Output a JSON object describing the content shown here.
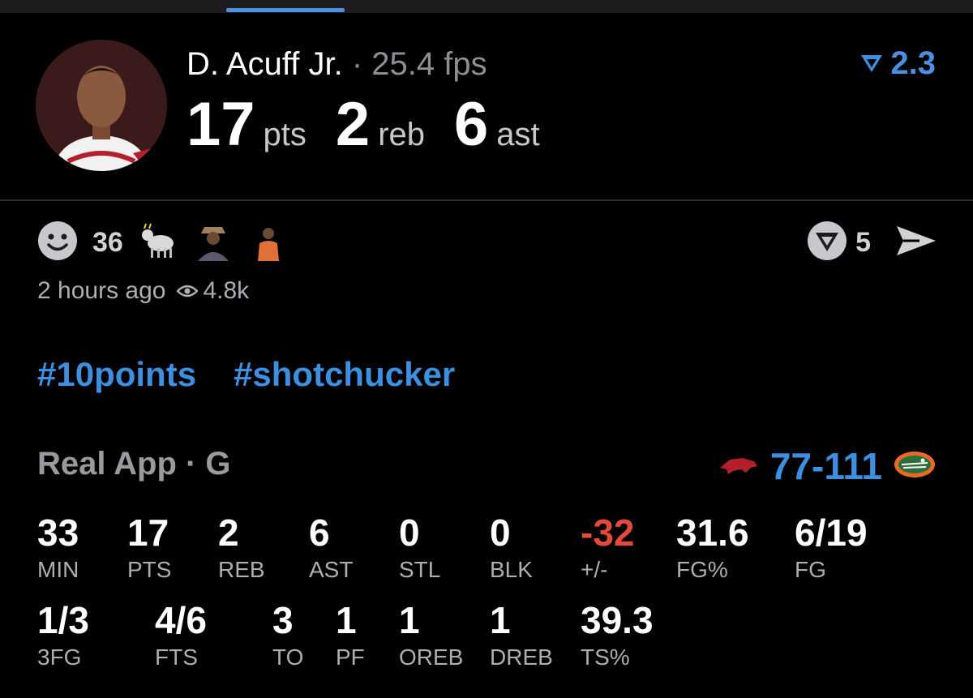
{
  "player": {
    "name": "D. Acuff Jr.",
    "separator": "·",
    "fps": "25.4 fps",
    "pts": "17",
    "pts_unit": "pts",
    "reb": "2",
    "reb_unit": "reb",
    "ast": "6",
    "ast_unit": "ast",
    "rating": "2.3"
  },
  "reactions": {
    "count": "36",
    "emojis": [
      "goat-emoji",
      "person-emoji-1",
      "person-emoji-2"
    ],
    "share_count": "5"
  },
  "meta": {
    "time": "2 hours ago",
    "views": "4.8k"
  },
  "tags": [
    "#10points",
    "#shotchucker"
  ],
  "game": {
    "league": "Real App · G",
    "score": "77-111"
  },
  "stats_row1": [
    {
      "value": "33",
      "label": "MIN"
    },
    {
      "value": "17",
      "label": "PTS"
    },
    {
      "value": "2",
      "label": "REB"
    },
    {
      "value": "6",
      "label": "AST"
    },
    {
      "value": "0",
      "label": "STL"
    },
    {
      "value": "0",
      "label": "BLK"
    },
    {
      "value": "-32",
      "label": "+/-"
    },
    {
      "value": "31.6",
      "label": "FG%"
    },
    {
      "value": "6/19",
      "label": "FG"
    }
  ],
  "stats_row2": [
    {
      "value": "1/3",
      "label": "3FG"
    },
    {
      "value": "4/6",
      "label": "FTS"
    },
    {
      "value": "3",
      "label": "TO"
    },
    {
      "value": "1",
      "label": "PF"
    },
    {
      "value": "1",
      "label": "OREB"
    },
    {
      "value": "1",
      "label": "DREB"
    },
    {
      "value": "39.3",
      "label": "TS%"
    }
  ],
  "colors": {
    "accent": "#3d8fe0",
    "negative": "#e5483c",
    "muted": "#8e8e93"
  }
}
